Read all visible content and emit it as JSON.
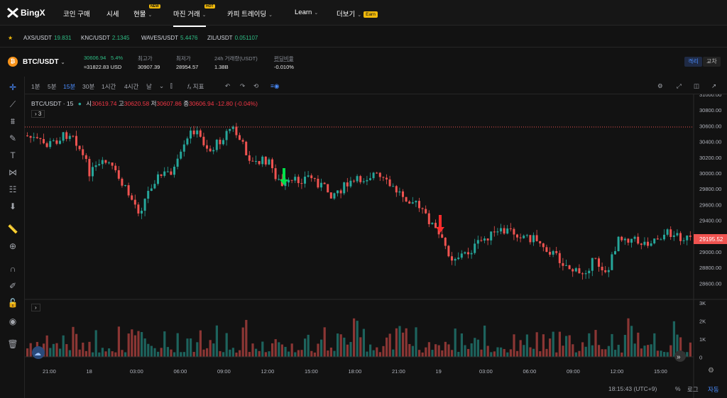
{
  "nav": {
    "logo": "BingX",
    "items": [
      {
        "label": "코인 구매",
        "chev": false
      },
      {
        "label": "시세",
        "chev": false
      },
      {
        "label": "현물",
        "chev": true,
        "badge": "NEW"
      },
      {
        "label": "마진 거래",
        "chev": true,
        "badge": "HOT",
        "active": true
      },
      {
        "label": "카피 트레이딩",
        "chev": true
      },
      {
        "label": "Learn",
        "chev": true
      },
      {
        "label": "더보기",
        "chev": true,
        "earn": "Earn"
      }
    ]
  },
  "tickers": [
    {
      "pair": "AXS/USDT",
      "price": "19.831"
    },
    {
      "pair": "KNC/USDT",
      "price": "2.1345"
    },
    {
      "pair": "WAVES/USDT",
      "price": "5.4476"
    },
    {
      "pair": "ZIL/USDT",
      "price": "0.051107"
    }
  ],
  "market": {
    "pair": "BTC/USDT",
    "last": "30606.94",
    "change": "5.4%",
    "usd": "≈31822.83 USD",
    "high_label": "최고가",
    "high": "30907.39",
    "low_label": "최저가",
    "low": "28954.57",
    "vol_label": "24h 거래량(USDT)",
    "vol": "1.38B",
    "fund_label": "펀딩비율",
    "fund": "-0.010%",
    "seg": [
      "격리",
      "교차"
    ]
  },
  "toolbar": {
    "intervals": [
      "1분",
      "5분",
      "15분",
      "30분",
      "1시간",
      "4시간",
      "날"
    ],
    "active": "15분",
    "indicator": "지표"
  },
  "legend": {
    "title": "BTC/USDT · 15",
    "o_label": "시",
    "o": "30619.74",
    "h_label": "고",
    "h": "30620.58",
    "l_label": "저",
    "l": "30607.86",
    "c_label": "종",
    "c": "30606.94",
    "chg": "-12.80 (-0.04%)",
    "collapse": "3"
  },
  "yaxis": [
    "31000.00",
    "30800.00",
    "30600.00",
    "30400.00",
    "30200.00",
    "30000.00",
    "29800.00",
    "29600.00",
    "29400.00",
    "29200.00",
    "29000.00",
    "28800.00",
    "28600.00"
  ],
  "vaxis": [
    "3K",
    "2K",
    "1K",
    "0"
  ],
  "xaxis": [
    "21:00",
    "18",
    "03:00",
    "06:00",
    "09:00",
    "12:00",
    "15:00",
    "18:00",
    "21:00",
    "19",
    "03:00",
    "06:00",
    "09:00",
    "12:00",
    "15:00"
  ],
  "price_tag": "29195.52",
  "status": {
    "time": "18:15:43 (UTC+9)",
    "pct": "%",
    "log": "로그",
    "auto": "자동"
  },
  "colors": {
    "up": "#26a69a",
    "down": "#ef5350"
  }
}
